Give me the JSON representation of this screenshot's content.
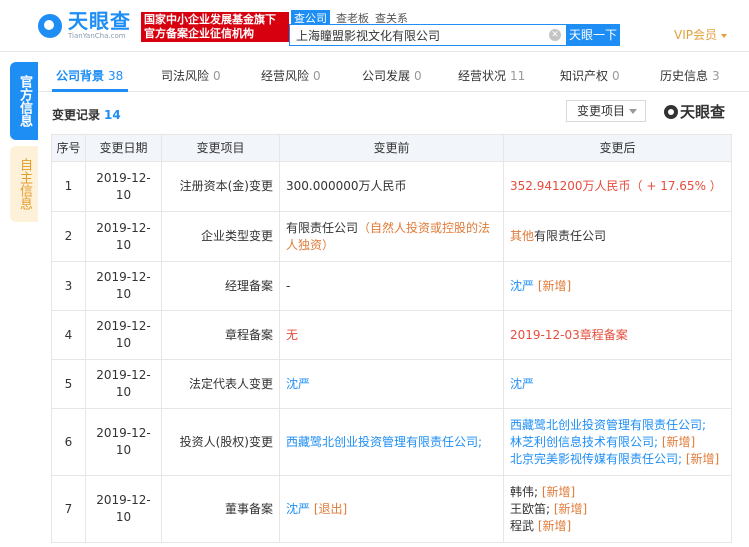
{
  "header": {
    "logo_cn": "天眼查",
    "logo_en": "TianYanCha.com",
    "slogan_line1": "国家中小企业发展基金旗下",
    "slogan_line2": "官方备案企业征信机构",
    "search_tabs": [
      "查公司",
      "查老板",
      "查关系"
    ],
    "search_value": "上海瞳盟影视文化有限公司",
    "search_button": "天眼一下",
    "vip_label": "VIP会员"
  },
  "side": {
    "official_label": "官方信息",
    "self_label": "自主信息"
  },
  "tabs": [
    {
      "label": "公司背景",
      "count": "38"
    },
    {
      "label": "司法风险",
      "count": "0"
    },
    {
      "label": "经营风险",
      "count": "0"
    },
    {
      "label": "公司发展",
      "count": "0"
    },
    {
      "label": "经营状况",
      "count": "11"
    },
    {
      "label": "知识产权",
      "count": "0"
    },
    {
      "label": "历史信息",
      "count": "3"
    }
  ],
  "section": {
    "title": "变更记录",
    "count": "14",
    "filter_label": "变更项目",
    "watermark": "天眼查"
  },
  "table": {
    "headers": [
      "序号",
      "变更日期",
      "变更项目",
      "变更前",
      "变更后"
    ],
    "rows": [
      {
        "idx": "1",
        "date": "2019-12-10",
        "item": "注册资本(金)变更",
        "before": [
          {
            "t": "300.000000万人民币",
            "c": ""
          }
        ],
        "after": [
          {
            "t": "352.941200万人民币（ + 17.65% ）",
            "c": "red"
          }
        ]
      },
      {
        "idx": "2",
        "date": "2019-12-10",
        "item": "企业类型变更",
        "before": [
          {
            "t": "有限责任公司",
            "c": ""
          },
          {
            "t": "（自然人投资或控股的法人独资）",
            "c": "orange"
          }
        ],
        "after": [
          {
            "t": "其他",
            "c": "orange"
          },
          {
            "t": "有限责任公司",
            "c": ""
          }
        ]
      },
      {
        "idx": "3",
        "date": "2019-12-10",
        "item": "经理备案",
        "before": [
          {
            "t": "-",
            "c": ""
          }
        ],
        "after": [
          {
            "t": "沈严",
            "c": "blue"
          },
          {
            "t": " [新增]",
            "c": "orange"
          }
        ]
      },
      {
        "idx": "4",
        "date": "2019-12-10",
        "item": "章程备案",
        "before": [
          {
            "t": "无",
            "c": "red"
          }
        ],
        "after": [
          {
            "t": "2019-12-03章程备案",
            "c": "red"
          }
        ]
      },
      {
        "idx": "5",
        "date": "2019-12-10",
        "item": "法定代表人变更",
        "before": [
          {
            "t": "沈严",
            "c": "blue"
          }
        ],
        "after": [
          {
            "t": "沈严",
            "c": "blue"
          }
        ]
      },
      {
        "idx": "6",
        "date": "2019-12-10",
        "item": "投资人(股权)变更",
        "before": [
          {
            "t": "西藏鹭北创业投资管理有限责任公司;",
            "c": "blue"
          }
        ],
        "after_lines": [
          [
            {
              "t": "西藏鹭北创业投资管理有限责任公司;",
              "c": "blue"
            }
          ],
          [
            {
              "t": "林芝利创信息技术有限公司;",
              "c": "blue"
            },
            {
              "t": " [新增]",
              "c": "orange"
            }
          ],
          [
            {
              "t": "北京完美影视传媒有限责任公司;",
              "c": "blue"
            },
            {
              "t": " [新增]",
              "c": "orange"
            }
          ]
        ]
      },
      {
        "idx": "7",
        "date": "2019-12-10",
        "item": "董事备案",
        "before": [
          {
            "t": "沈严",
            "c": "blue"
          },
          {
            "t": " [退出]",
            "c": "orange"
          }
        ],
        "after_lines": [
          [
            {
              "t": "韩伟;",
              "c": ""
            },
            {
              "t": " [新增]",
              "c": "orange"
            }
          ],
          [
            {
              "t": "王欧笛;",
              "c": ""
            },
            {
              "t": " [新增]",
              "c": "orange"
            }
          ],
          [
            {
              "t": "程武",
              "c": ""
            },
            {
              "t": " [新增]",
              "c": "orange"
            }
          ]
        ]
      }
    ]
  }
}
